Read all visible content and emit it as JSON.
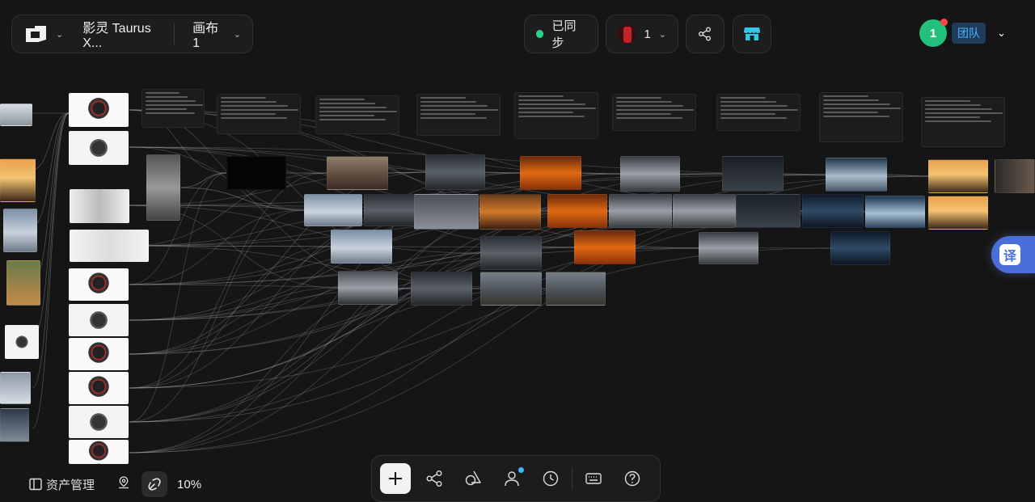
{
  "header": {
    "project_title": "影灵 Taurus X...",
    "canvas_name": "画布 1",
    "sync_status": "已同步",
    "collaborator_count": "1",
    "team_count": "1",
    "team_label": "团队"
  },
  "side": {
    "translate_label": "译"
  },
  "footer": {
    "assets_label": "资产管理",
    "zoom_level": "10%"
  },
  "colors": {
    "background": "#151515",
    "accent_green": "#2bd28a",
    "accent_blue": "#48b3ff",
    "translate_blue": "#4a6fd8",
    "store_cyan": "#35c7e8"
  },
  "icons": {
    "logo": "logo-icon",
    "share": "share-icon",
    "store": "store-icon",
    "workflow": "workflow-icon",
    "shapes": "shapes-icon",
    "person": "person-icon",
    "history": "clock-icon",
    "keyboard": "keyboard-icon",
    "help": "help-icon",
    "add": "plus-icon",
    "panel": "sidebar-panel-icon",
    "location": "location-pin-icon",
    "snap": "snap-link-icon"
  }
}
